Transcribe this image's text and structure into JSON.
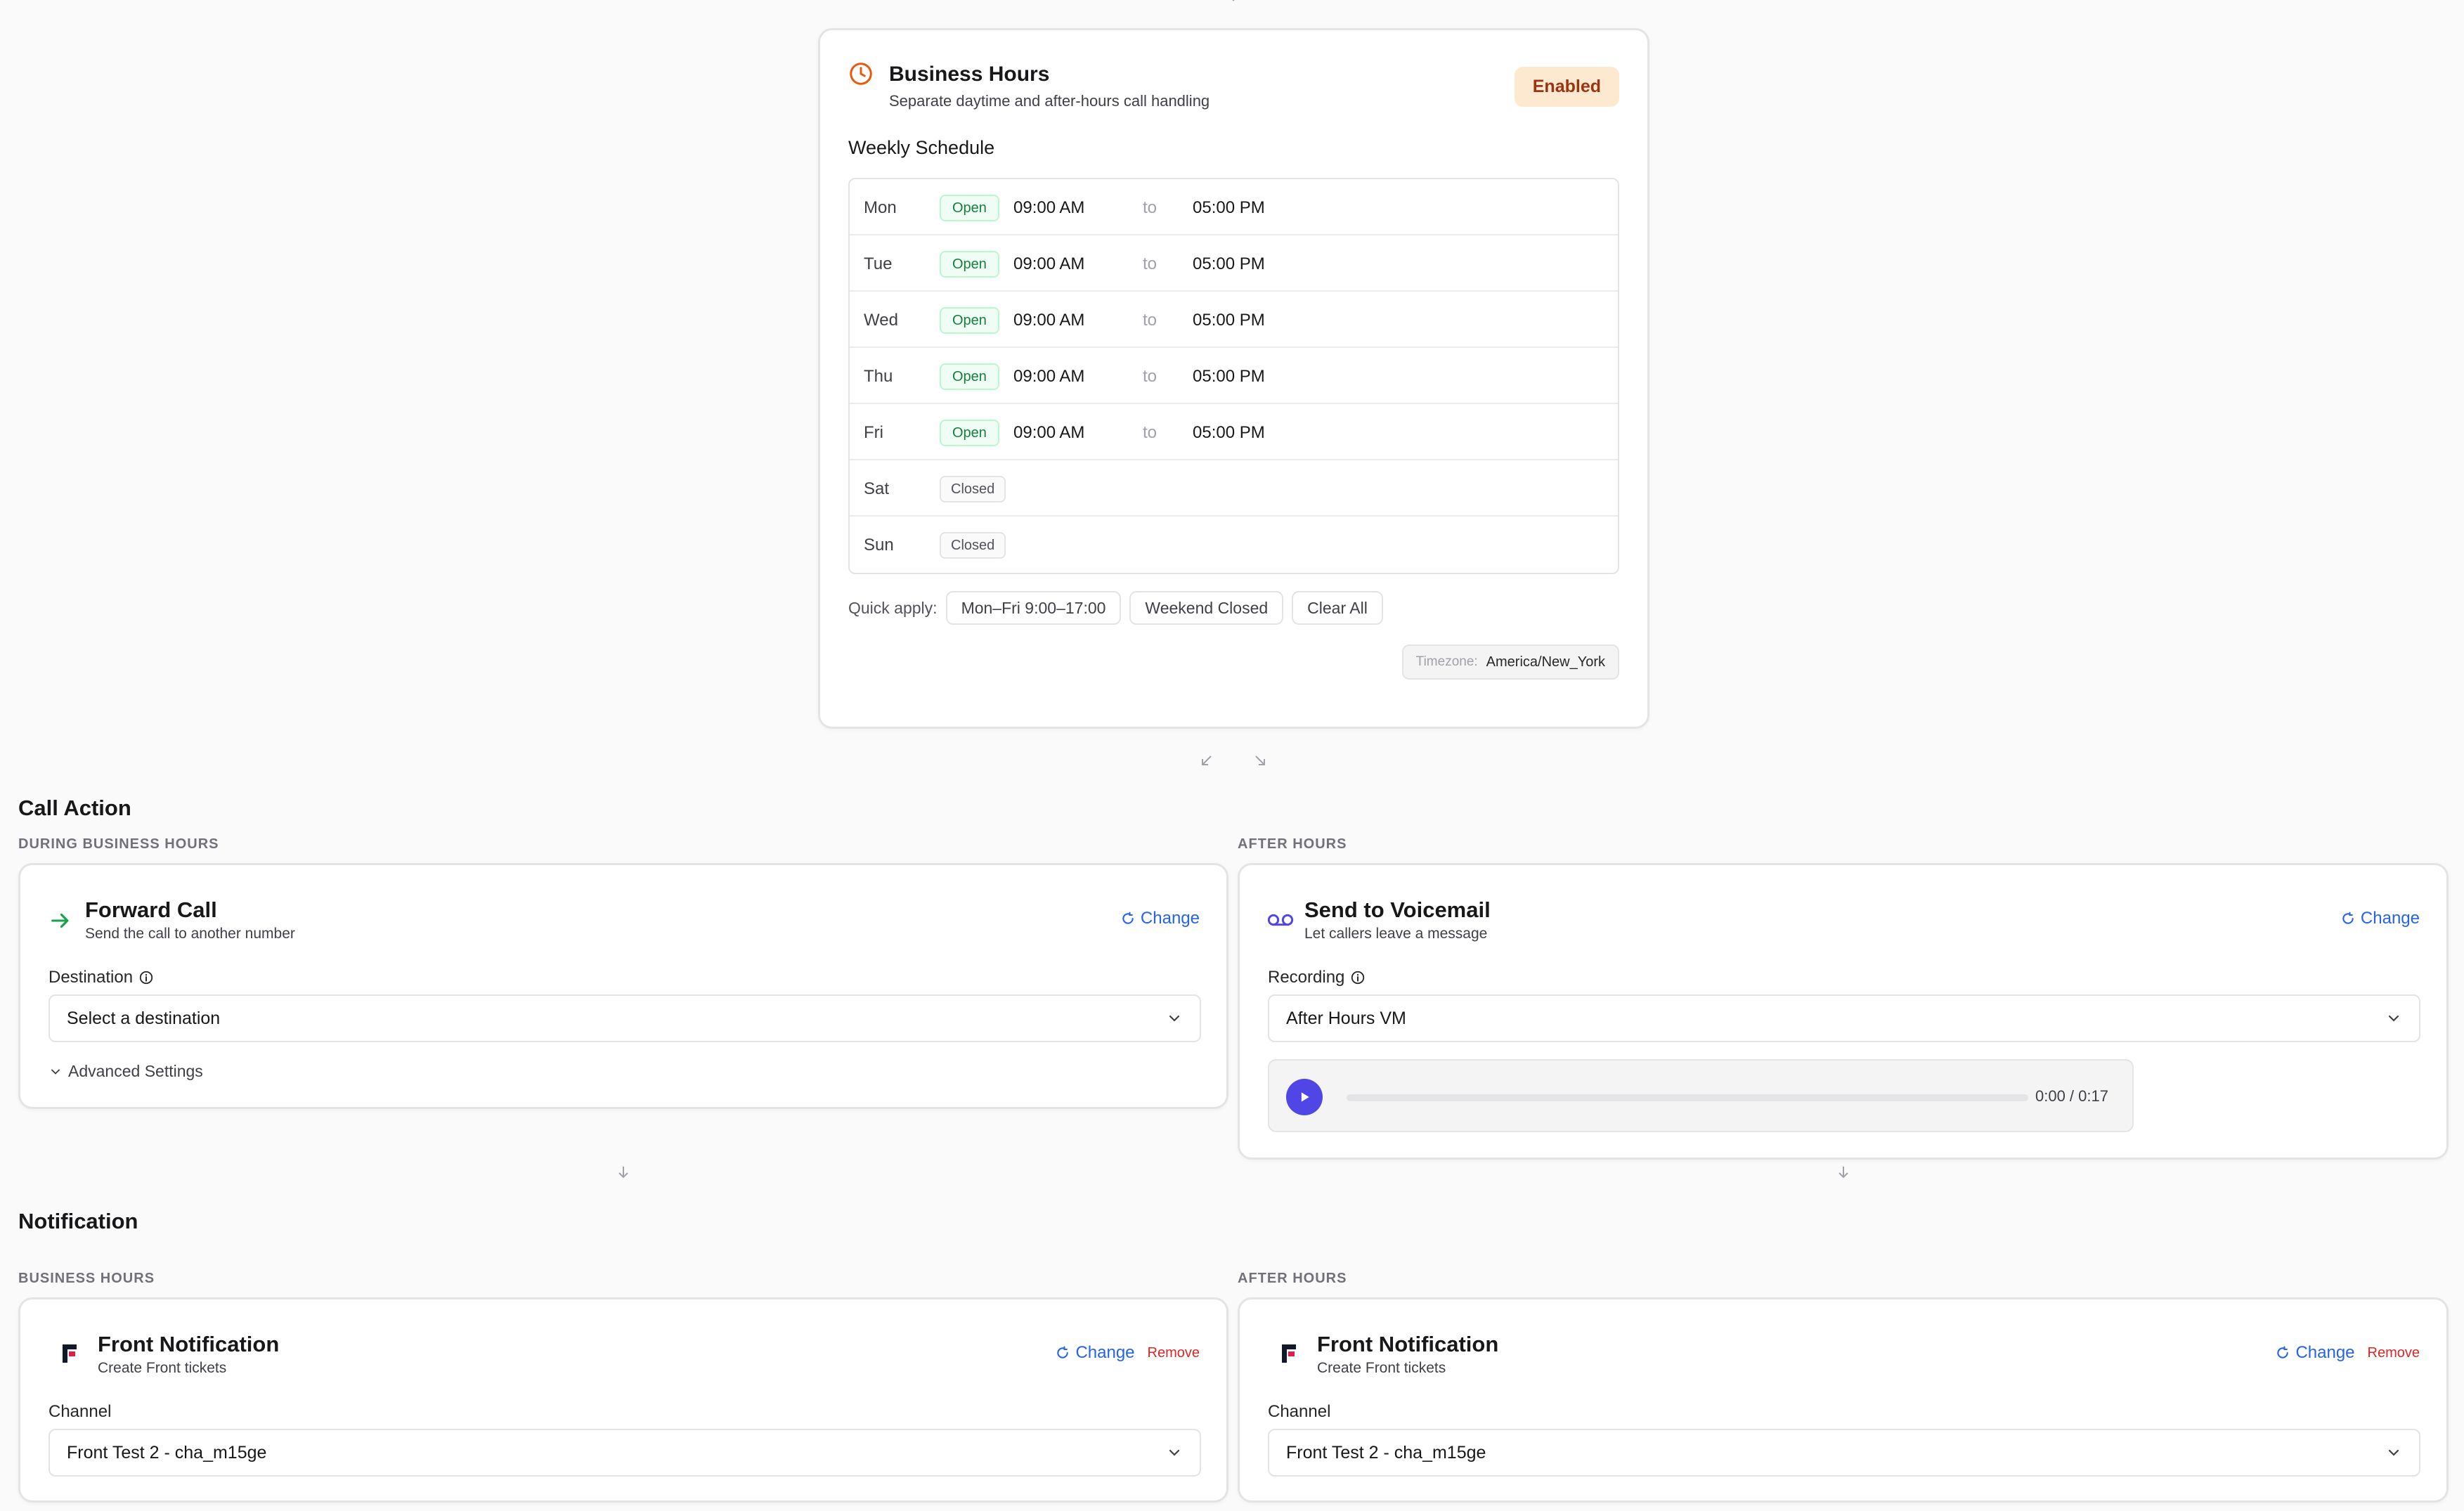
{
  "business_hours": {
    "title": "Business Hours",
    "subtitle": "Separate daytime and after-hours call handling",
    "status": "Enabled",
    "schedule_heading": "Weekly Schedule",
    "days": [
      {
        "day": "Mon",
        "status": "Open",
        "open": "09:00 AM",
        "sep": "to",
        "close": "05:00 PM"
      },
      {
        "day": "Tue",
        "status": "Open",
        "open": "09:00 AM",
        "sep": "to",
        "close": "05:00 PM"
      },
      {
        "day": "Wed",
        "status": "Open",
        "open": "09:00 AM",
        "sep": "to",
        "close": "05:00 PM"
      },
      {
        "day": "Thu",
        "status": "Open",
        "open": "09:00 AM",
        "sep": "to",
        "close": "05:00 PM"
      },
      {
        "day": "Fri",
        "status": "Open",
        "open": "09:00 AM",
        "sep": "to",
        "close": "05:00 PM"
      },
      {
        "day": "Sat",
        "status": "Closed"
      },
      {
        "day": "Sun",
        "status": "Closed"
      }
    ],
    "quick_apply_label": "Quick apply:",
    "quick_apply": [
      "Mon–Fri 9:00–17:00",
      "Weekend Closed",
      "Clear All"
    ],
    "timezone_label": "Timezone:",
    "timezone_value": "America/New_York"
  },
  "call_action": {
    "title": "Call Action",
    "business_label": "DURING BUSINESS HOURS",
    "after_label": "AFTER HOURS",
    "forward": {
      "title": "Forward Call",
      "subtitle": "Send the call to another number",
      "change": "Change",
      "field_label": "Destination",
      "placeholder": "Select a destination",
      "advanced": "Advanced Settings"
    },
    "voicemail": {
      "title": "Send to Voicemail",
      "subtitle": "Let callers leave a message",
      "change": "Change",
      "field_label": "Recording",
      "value": "After Hours VM",
      "time": "0:00 / 0:17",
      "progress": 0
    }
  },
  "notification": {
    "title": "Notification",
    "business_label": "BUSINESS HOURS",
    "after_label": "AFTER HOURS",
    "business": {
      "title": "Front Notification",
      "subtitle": "Create Front tickets",
      "change": "Change",
      "remove": "Remove",
      "field_label": "Channel",
      "value": "Front Test 2 - cha_m15ge"
    },
    "after": {
      "title": "Front Notification",
      "subtitle": "Create Front tickets",
      "change": "Change",
      "remove": "Remove",
      "field_label": "Channel",
      "value": "Front Test 2 - cha_m15ge"
    }
  },
  "colors": {
    "accent_orange": "#ea580c",
    "link_blue": "#2563eb",
    "play_purple": "#4f46e5",
    "forward_green": "#16a34a"
  }
}
